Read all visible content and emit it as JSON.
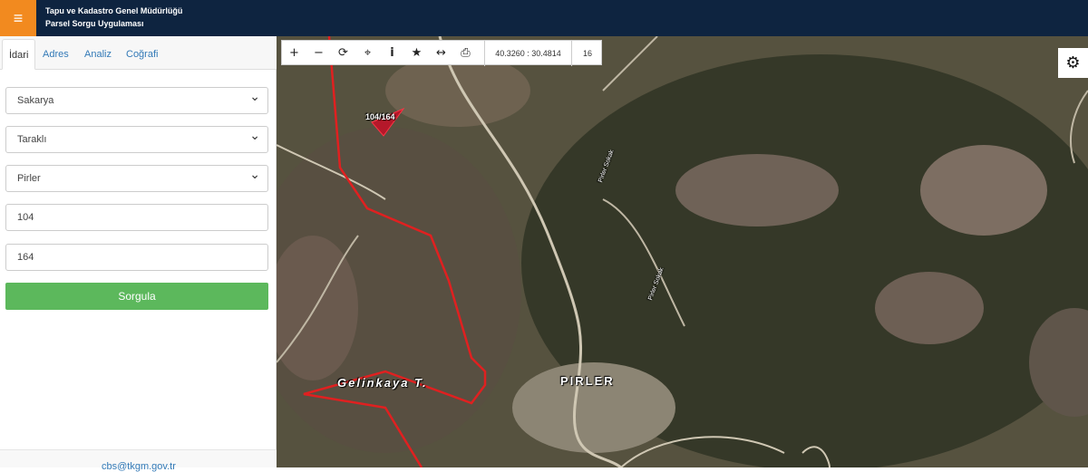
{
  "header": {
    "menu_icon": "≡",
    "title_line1": "Tapu ve Kadastro Genel Müdürlüğü",
    "title_line2": "Parsel Sorgu Uygulaması",
    "menu_color": "#f28a1f",
    "background_color": "#0e2440"
  },
  "sidebar": {
    "tabs": [
      {
        "label": "İdari",
        "active": true
      },
      {
        "label": "Adres",
        "active": false
      },
      {
        "label": "Analiz",
        "active": false
      },
      {
        "label": "Coğrafi",
        "active": false
      }
    ],
    "fields": {
      "il": "Sakarya",
      "ilce": "Taraklı",
      "mahalle": "Pirler",
      "ada": "104",
      "parsel": "164"
    },
    "query_button": "Sorgula",
    "query_button_color": "#5cb85c",
    "footer_email": "cbs@tkgm.gov.tr"
  },
  "map_toolbar": {
    "zoom_in": "+",
    "zoom_out": "−",
    "refresh": "⟳",
    "locate": "⌖",
    "info": "i",
    "favorite": "★",
    "measure": "↔",
    "print": "⎙",
    "coordinates": "40.3260 : 30.4814",
    "zoom_level": "16"
  },
  "map": {
    "parcel_label": "104/164",
    "place_labels": [
      "Gelinkaya T.",
      "PIRLER"
    ],
    "road_labels": [
      "Pirler Sokak",
      "Pirler Sokak"
    ],
    "boundary_color": "#e02020"
  },
  "settings_icon": "⚙"
}
